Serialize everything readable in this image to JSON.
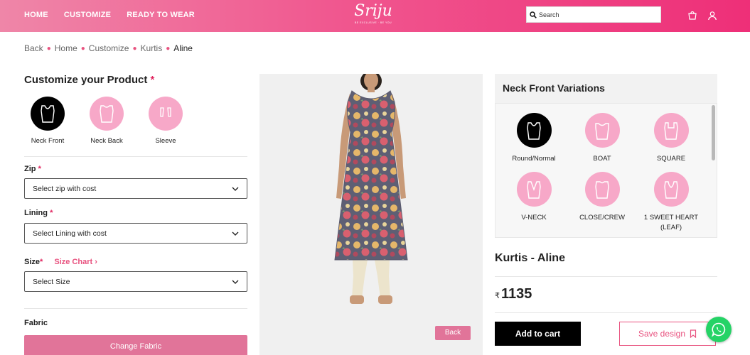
{
  "header": {
    "nav": [
      "HOME",
      "CUSTOMIZE",
      "READY TO WEAR"
    ],
    "brand": "Sriju",
    "tagline": "BE EXCLUSIVE · BE YOU",
    "search_placeholder": "Search"
  },
  "breadcrumb": [
    "Back",
    "Home",
    "Customize",
    "Kurtis",
    "Aline"
  ],
  "customize": {
    "title": "Customize your Product",
    "required_mark": "*",
    "options": [
      {
        "label": "Neck Front",
        "selected": true
      },
      {
        "label": "Neck Back",
        "selected": false
      },
      {
        "label": "Sleeve",
        "selected": false
      }
    ],
    "zip": {
      "label": "Zip",
      "value": "Select zip with cost"
    },
    "lining": {
      "label": "Lining",
      "value": "Select Lining with cost"
    },
    "size": {
      "label": "Size",
      "chart_link": "Size Chart",
      "value": "Select Size"
    },
    "fabric": {
      "label": "Fabric",
      "button": "Change Fabric"
    }
  },
  "preview": {
    "back_button": "Back"
  },
  "variations": {
    "title": "Neck Front Variations",
    "items": [
      {
        "label": "Round/Normal",
        "selected": true
      },
      {
        "label": "BOAT",
        "selected": false
      },
      {
        "label": "SQUARE",
        "selected": false
      },
      {
        "label": "V-NECK",
        "selected": false
      },
      {
        "label": "CLOSE/CREW",
        "selected": false
      },
      {
        "label": "1 SWEET HEART (LEAF)",
        "selected": false
      }
    ]
  },
  "product": {
    "name": "Kurtis - Aline",
    "currency": "₹",
    "price": "1135",
    "add_to_cart": "Add to cart",
    "save_design": "Save design"
  },
  "colors": {
    "brand_pink": "#ee2f78",
    "accent": "#e17499",
    "whatsapp": "#25d366"
  }
}
